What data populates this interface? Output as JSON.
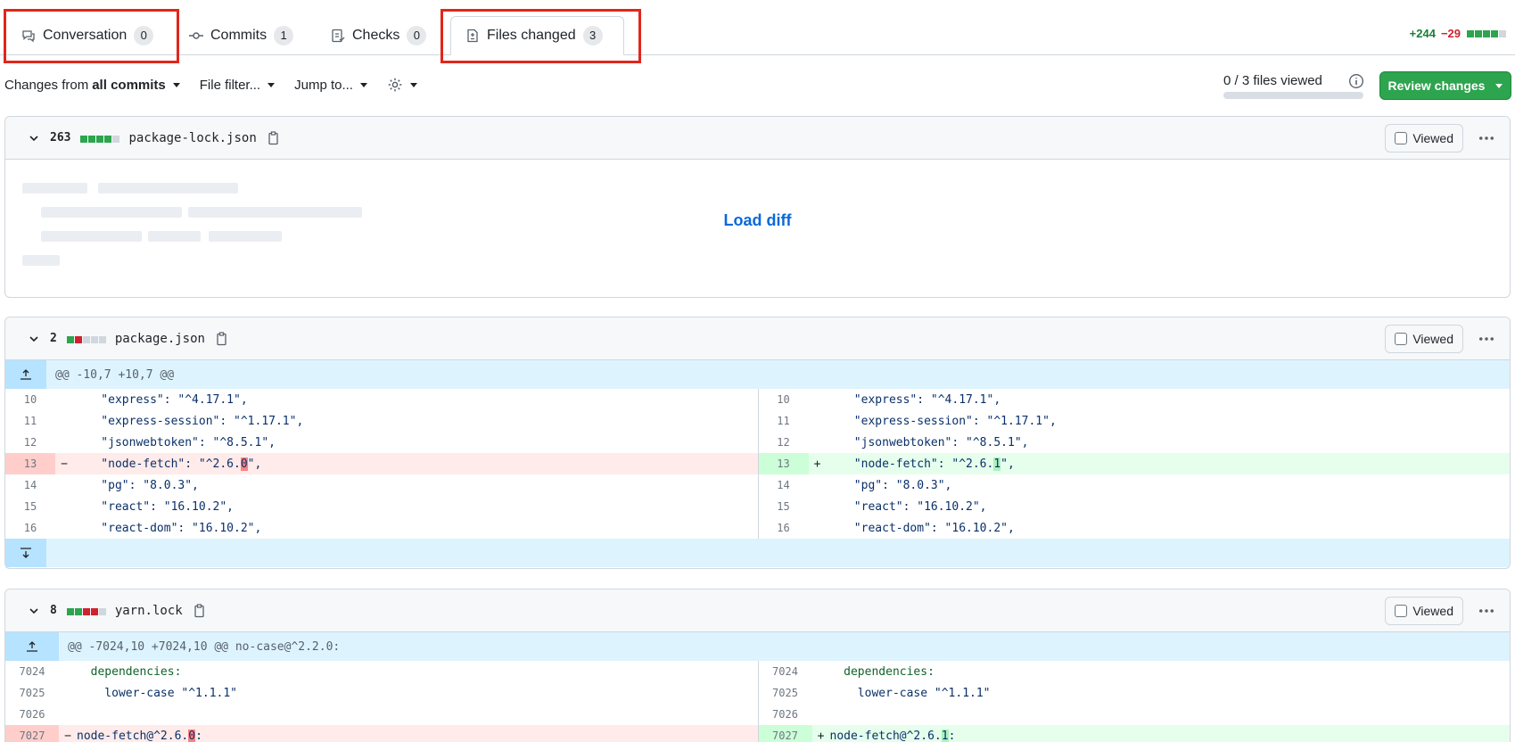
{
  "tabs": [
    {
      "label": "Conversation",
      "count": "0"
    },
    {
      "label": "Commits",
      "count": "1"
    },
    {
      "label": "Checks",
      "count": "0"
    },
    {
      "label": "Files changed",
      "count": "3"
    }
  ],
  "diffstat": {
    "additions": "+244",
    "deletions": "−29"
  },
  "toolbar": {
    "changes_prefix": "Changes from",
    "changes_value": "all commits",
    "file_filter": "File filter...",
    "jump_to": "Jump to...",
    "files_viewed": "0 / 3 files viewed",
    "review_button": "Review changes"
  },
  "files": [
    {
      "count": "263",
      "name": "package-lock.json",
      "viewed_label": "Viewed",
      "load_diff": "Load diff"
    },
    {
      "count": "2",
      "name": "package.json",
      "viewed_label": "Viewed",
      "hunk": "@@ -10,7 +10,7 @@",
      "left": [
        {
          "n": "10",
          "c": "    \"express\": \"^4.17.1\","
        },
        {
          "n": "11",
          "c": "    \"express-session\": \"^1.17.1\","
        },
        {
          "n": "12",
          "c": "    \"jsonwebtoken\": \"^8.5.1\","
        },
        {
          "n": "13",
          "pre": "    \"node-fetch\": \"^2.6.",
          "word": "0",
          "post": "\","
        },
        {
          "n": "14",
          "c": "    \"pg\": \"8.0.3\","
        },
        {
          "n": "15",
          "c": "    \"react\": \"16.10.2\","
        },
        {
          "n": "16",
          "c": "    \"react-dom\": \"16.10.2\","
        }
      ],
      "right": [
        {
          "n": "10",
          "c": "    \"express\": \"^4.17.1\","
        },
        {
          "n": "11",
          "c": "    \"express-session\": \"^1.17.1\","
        },
        {
          "n": "12",
          "c": "    \"jsonwebtoken\": \"^8.5.1\","
        },
        {
          "n": "13",
          "pre": "    \"node-fetch\": \"^2.6.",
          "word": "1",
          "post": "\","
        },
        {
          "n": "14",
          "c": "    \"pg\": \"8.0.3\","
        },
        {
          "n": "15",
          "c": "    \"react\": \"16.10.2\","
        },
        {
          "n": "16",
          "c": "    \"react-dom\": \"16.10.2\","
        }
      ]
    },
    {
      "count": "8",
      "name": "yarn.lock",
      "viewed_label": "Viewed",
      "hunk": "@@ -7024,10 +7024,10 @@ no-case@^2.2.0:",
      "left": [
        {
          "n": "7024",
          "c": "  dependencies:"
        },
        {
          "n": "7025",
          "c": "    lower-case \"^1.1.1\""
        },
        {
          "n": "7026",
          "c": ""
        },
        {
          "n": "7027",
          "pre": "node-fetch@^2.6.",
          "word": "0",
          "post": ":"
        }
      ],
      "right": [
        {
          "n": "7024",
          "c": "  dependencies:"
        },
        {
          "n": "7025",
          "c": "    lower-case \"^1.1.1\""
        },
        {
          "n": "7026",
          "c": ""
        },
        {
          "n": "7027",
          "pre": "node-fetch@^2.6.",
          "word": "1",
          "post": ":"
        }
      ]
    }
  ]
}
